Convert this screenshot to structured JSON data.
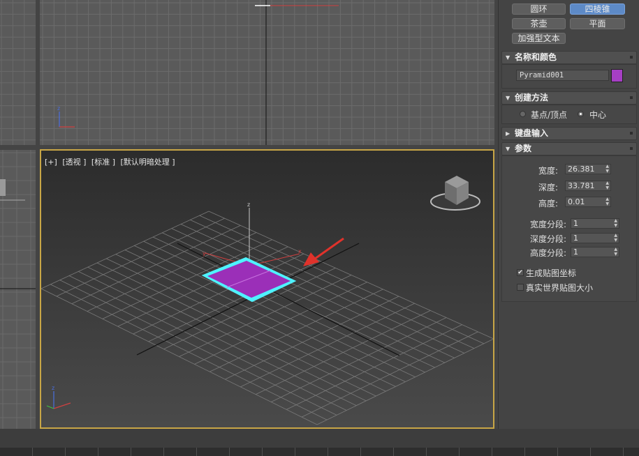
{
  "viewport": {
    "label_plus": "[+]",
    "label_view": "[透视 ]",
    "label_shading": "[标准 ]",
    "label_lighting": "[默认明暗处理 ]"
  },
  "panel": {
    "buttons": {
      "torus": "圆环",
      "pyramid": "四棱锥",
      "teapot": "茶壶",
      "plane": "平面",
      "text_plus": "加强型文本"
    },
    "name_color": {
      "title": "名称和颜色",
      "name_value": "Pyramid001",
      "color": "#a63fc4"
    },
    "creation_method": {
      "title": "创建方法",
      "option_base": "基点/顶点",
      "option_center": "中心",
      "selected": "center"
    },
    "keyboard_entry": {
      "title": "键盘输入"
    },
    "parameters": {
      "title": "参数",
      "width_label": "宽度:",
      "width_value": "26.381",
      "depth_label": "深度:",
      "depth_value": "33.781",
      "height_label": "高度:",
      "height_value": "0.01",
      "width_segs_label": "宽度分段:",
      "width_segs_value": "1",
      "depth_segs_label": "深度分段:",
      "depth_segs_value": "1",
      "height_segs_label": "高度分段:",
      "height_segs_value": "1",
      "gen_mapping_label": "生成贴图坐标",
      "gen_mapping_checked": true,
      "real_world_label": "真实世界贴图大小",
      "real_world_checked": false
    }
  },
  "colors": {
    "accent_active": "#5d8ac7",
    "viewport_border": "#c8a646",
    "object_fill": "#9b2fb8",
    "selection_outline": "#4ff3ff",
    "annotation_arrow": "#e0322b"
  }
}
